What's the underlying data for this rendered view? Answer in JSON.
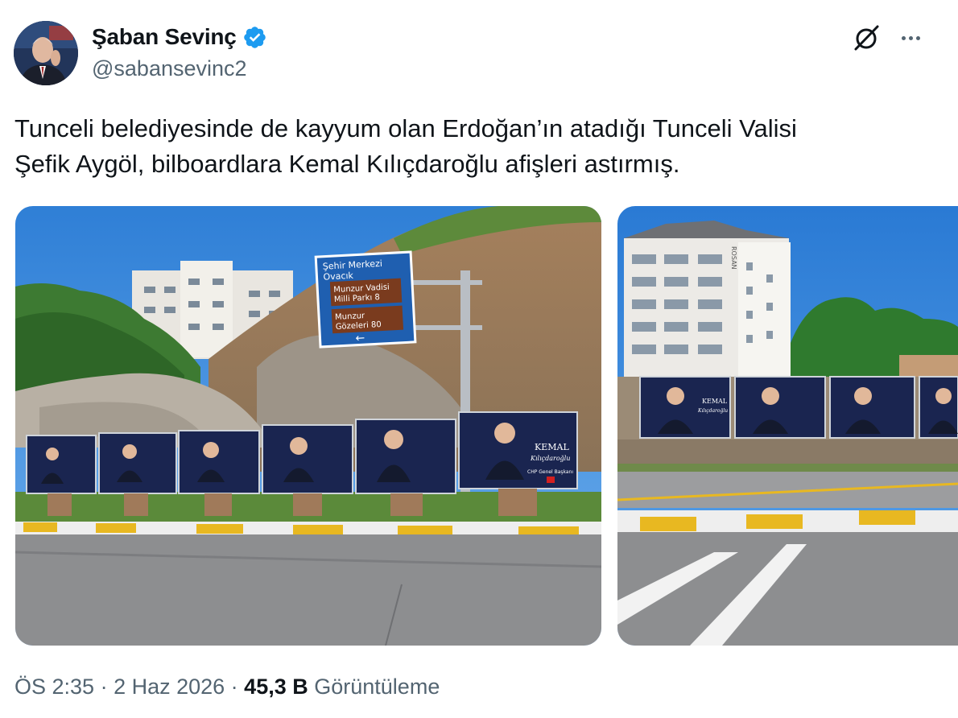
{
  "author": {
    "display_name": "Şaban Sevinç",
    "handle": "@sabansevinc2",
    "verified": true
  },
  "tweet": {
    "text_line1": "Tunceli belediyesinde de kayyum olan Erdoğan’ın atadığı Tunceli Valisi",
    "text_line2": "Şefik Aygöl, bilboardlara Kemal Kılıçdaroğlu afişleri astırmış."
  },
  "media": {
    "photo1": {
      "sign_top": "Şehir Merkezi",
      "sign_sub": "Ovacık",
      "sign_line1": "Munzur Vadisi",
      "sign_line2": "Milli Parkı 8",
      "sign_line3": "Munzur",
      "sign_line4": "Gözeleri 80",
      "sign_arrow": "←",
      "billboard_name": "KEMAL",
      "billboard_surname": "Kılıçdaroğlu",
      "billboard_role": "CHP Genel Başkanı"
    },
    "photo2": {
      "billboard_name": "KEMAL",
      "billboard_surname": "Kılıçdaroğlu",
      "building_sign": "ROSAN"
    }
  },
  "meta": {
    "time": "ÖS 2:35",
    "separator": " · ",
    "date": "2 Haz 2026",
    "views_count": "45,3 B",
    "views_label": "Görüntüleme"
  },
  "colors": {
    "text_primary": "#0f1419",
    "text_secondary": "#536471",
    "verified_blue": "#1d9bf0"
  },
  "icons": [
    "verified-badge-icon",
    "grok-icon",
    "more-options-icon"
  ]
}
